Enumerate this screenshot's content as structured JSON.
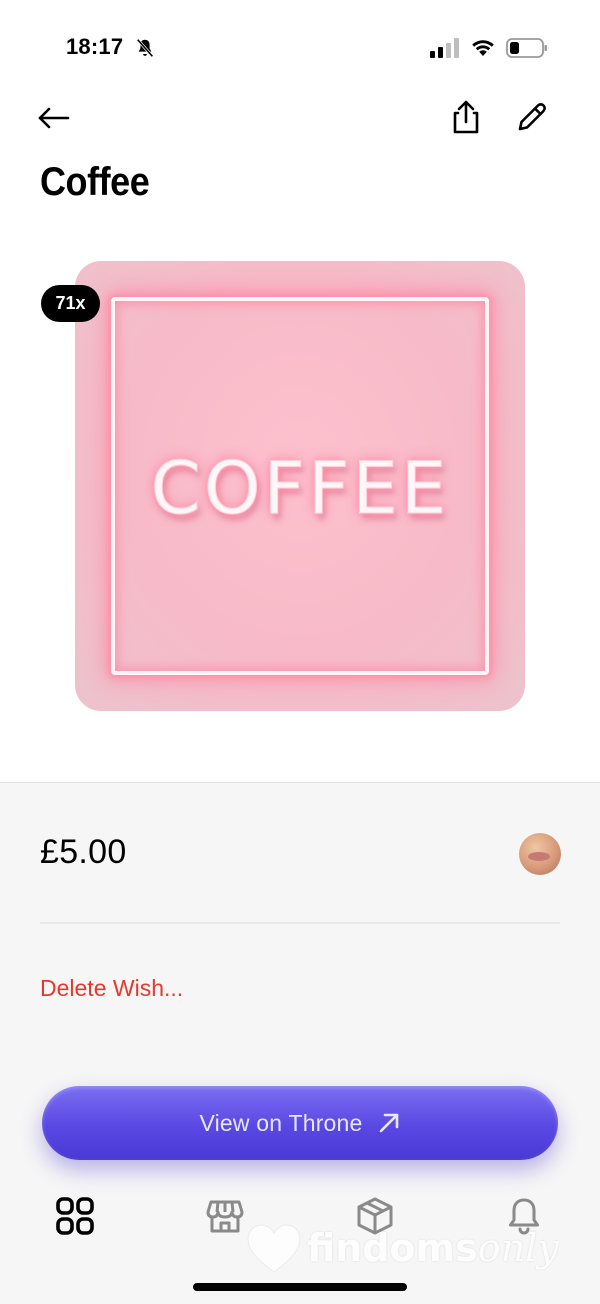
{
  "status_bar": {
    "time": "18:17",
    "icons": [
      "bell-slash-icon",
      "signal-icon",
      "wifi-icon",
      "battery-icon"
    ]
  },
  "nav": {
    "icons": [
      "back-arrow-icon",
      "share-icon",
      "edit-pencil-icon"
    ]
  },
  "page": {
    "title": "Coffee"
  },
  "wish": {
    "image_text": "COFFEE",
    "count_badge": "71x",
    "price": "£5.00",
    "delete_label": "Delete Wish...",
    "cta_label": "View on Throne",
    "cta_icon": "arrow-up-right-icon"
  },
  "tabs": [
    {
      "icon": "grid-icon",
      "active": true
    },
    {
      "icon": "storefront-icon",
      "active": false
    },
    {
      "icon": "box-icon",
      "active": false
    },
    {
      "icon": "bell-icon",
      "active": false
    }
  ],
  "watermark": {
    "text_bold": "findoms",
    "text_script": "only"
  },
  "colors": {
    "accent": "#5948e3",
    "danger": "#e6392e",
    "panel_bg": "#f6f6f6"
  }
}
